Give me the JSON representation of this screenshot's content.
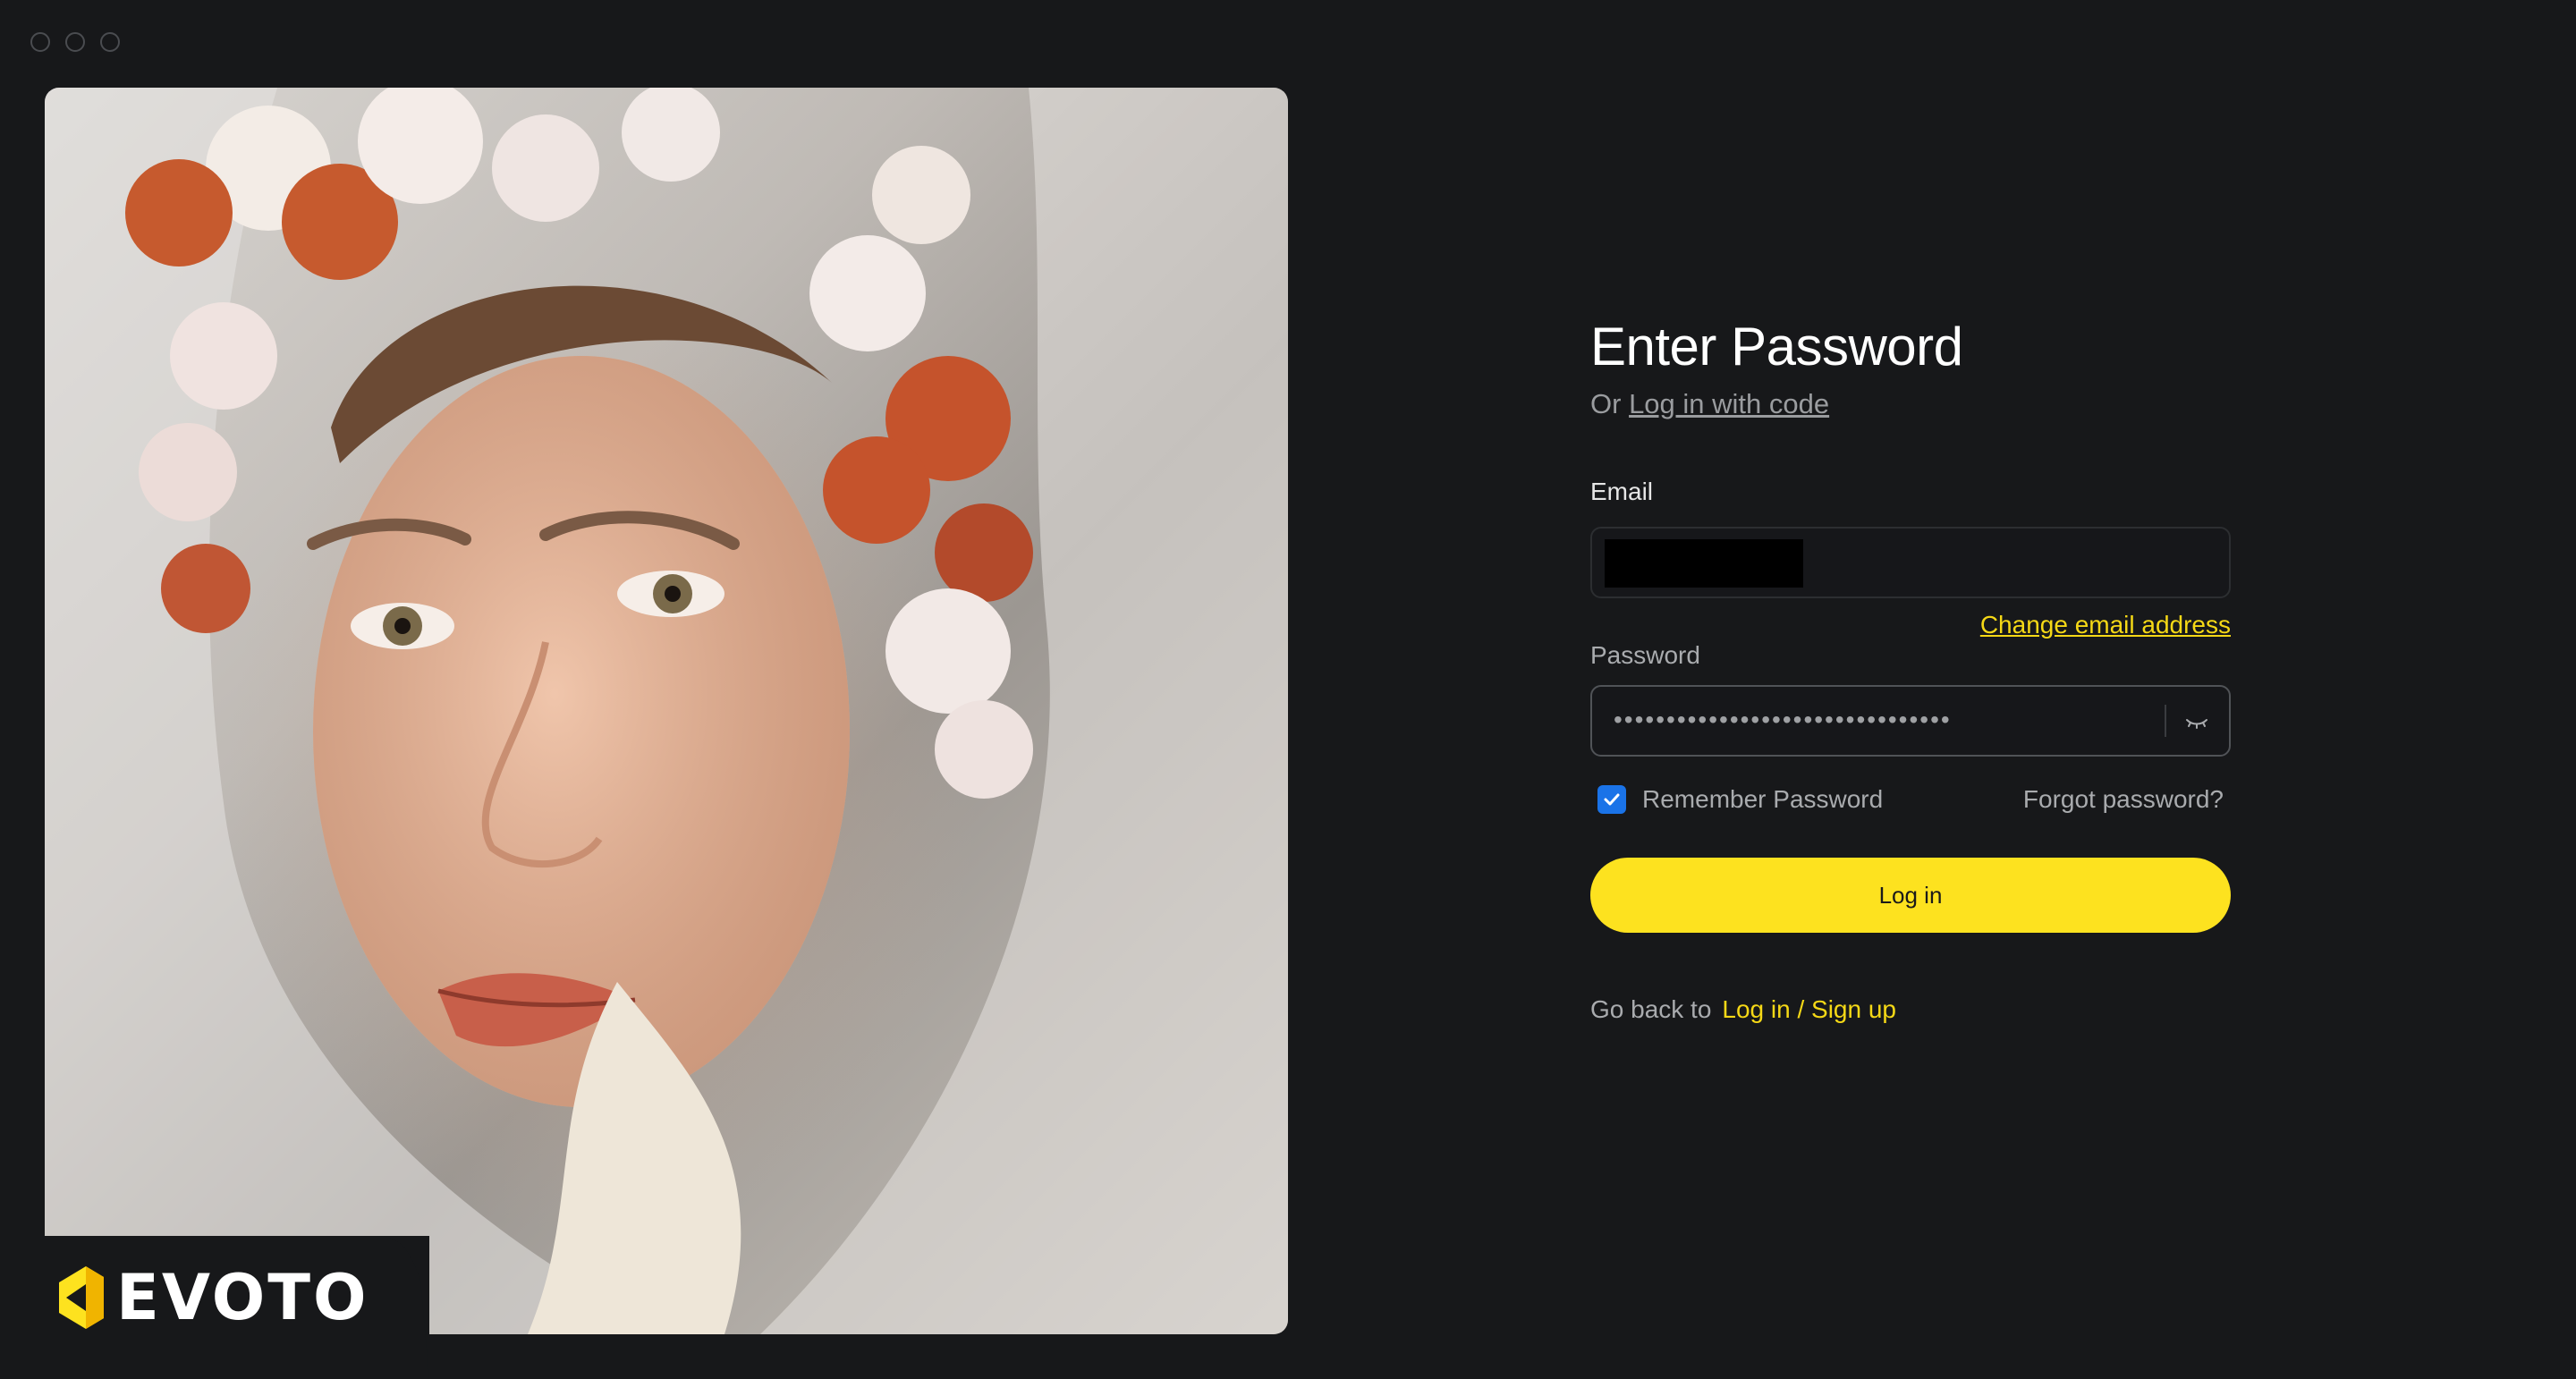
{
  "window": {
    "controls": [
      "close",
      "minimize",
      "maximize"
    ]
  },
  "brand": {
    "name": "EVOTO",
    "accent": "#fde21f"
  },
  "form": {
    "title": "Enter Password",
    "subtitle_prefix": "Or",
    "subtitle_link": "Log in with code",
    "email_label": "Email",
    "email_value_redacted": true,
    "change_email": "Change email address",
    "password_label": "Password",
    "password_masked": "••••••••••••••••••••••••••••••••",
    "remember_label": "Remember Password",
    "remember_checked": true,
    "forgot": "Forgot password?",
    "login_button": "Log in",
    "goback_text": "Go back to",
    "goback_link": "Log in / Sign up"
  },
  "colors": {
    "background": "#17181a",
    "accent_yellow": "#fde21f",
    "link_yellow": "#f5d816",
    "checkbox_blue": "#1a73e8"
  }
}
